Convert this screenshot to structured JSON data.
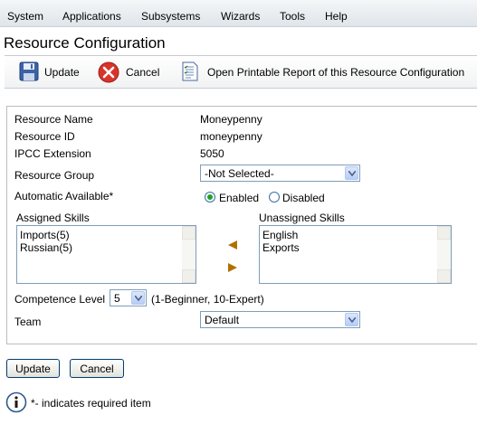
{
  "menu": [
    "System",
    "Applications",
    "Subsystems",
    "Wizards",
    "Tools",
    "Help"
  ],
  "page_title": "Resource Configuration",
  "toolbar": {
    "update_label": "Update",
    "cancel_label": "Cancel",
    "report_label": "Open Printable Report of this Resource Configuration"
  },
  "form": {
    "resource_name_label": "Resource Name",
    "resource_name_value": "Moneypenny",
    "resource_id_label": "Resource ID",
    "resource_id_value": "moneypenny",
    "ipcc_label": "IPCC Extension",
    "ipcc_value": "5050",
    "group_label": "Resource Group",
    "group_value": "-Not Selected-",
    "auto_label": "Automatic Available*",
    "enabled_label": "Enabled",
    "disabled_label": "Disabled",
    "auto_selected": "Enabled",
    "assigned_label": "Assigned Skills",
    "assigned_skills": [
      "Imports(5)",
      "Russian(5)"
    ],
    "unassigned_label": "Unassigned Skills",
    "unassigned_skills": [
      "English",
      "Exports"
    ],
    "competence_label": "Competence Level",
    "competence_value": "5",
    "competence_hint": "(1-Beginner, 10-Expert)",
    "team_label": "Team",
    "team_value": "Default"
  },
  "buttons": {
    "update_label": "Update",
    "cancel_label": "Cancel"
  },
  "footnote": "*- indicates required item",
  "colors": {
    "cancel_icon": "#d9342a",
    "arrow": "#b07000",
    "info_icon": "#2c5a8a"
  }
}
